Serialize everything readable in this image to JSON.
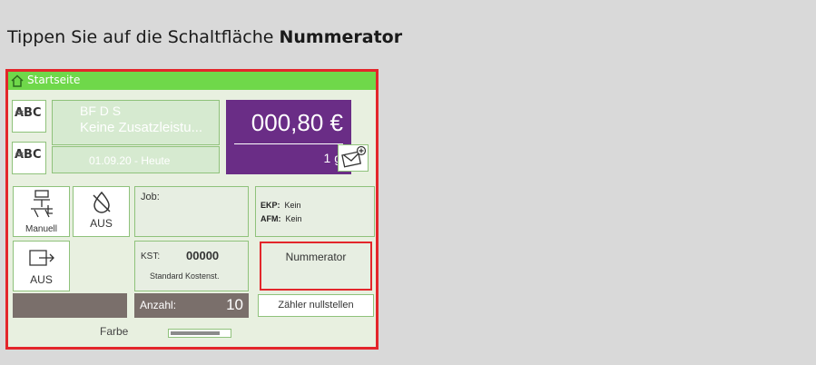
{
  "instruction": {
    "prefix": "Tippen Sie auf die Schaltfläche ",
    "target": "Nummerator"
  },
  "screen": {
    "topbar_title": "Startseite",
    "abc_label": "ABC",
    "product_line1": "BF D S",
    "product_line2": "Keine Zusatzleistu...",
    "date": "01.09.20 - Heute",
    "price": "000,80 €",
    "weight": "1 g",
    "manual_label": "Manuell",
    "ink_mode_label": "AUS",
    "feed_label": "AUS",
    "job_label": "Job:",
    "ekp_key": "EKP:",
    "ekp_value": "Kein",
    "afm_key": "AFM:",
    "afm_value": "Kein",
    "kst_key": "KST:",
    "kst_value": "00000",
    "kst_name": "Standard Kostenst.",
    "nummerator_label": "Nummerator",
    "anzahl_label": "Anzahl:",
    "anzahl_value": "10",
    "reset_label": "Zähler nullstellen",
    "farbe_label": "Farbe",
    "ink_level_fraction": 0.85
  },
  "colors": {
    "highlight": "#e3262b",
    "topbar": "#6fd84a",
    "price_bg": "#6a2d86",
    "counter_bg": "#7a6f6b"
  }
}
